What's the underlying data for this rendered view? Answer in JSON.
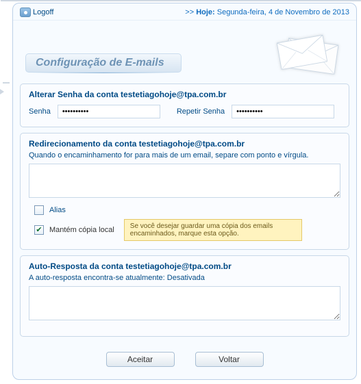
{
  "topbar": {
    "logoff_label": "Logoff",
    "date_prefix": ">> ",
    "date_bold": "Hoje:",
    "date_rest": " Segunda-feira, 4 de Novembro de 2013"
  },
  "page_title": "Configuração de E-mails",
  "account_email": "testetiagohoje@tpa.com.br",
  "password_section": {
    "heading": "Alterar Senha da conta testetiagohoje@tpa.com.br",
    "label1": "Senha",
    "value1": "••••••••••",
    "label2": "Repetir Senha",
    "value2": "••••••••••"
  },
  "redirect_section": {
    "heading": "Redirecionamento da conta testetiagohoje@tpa.com.br",
    "instructions": "Quando o encaminhamento for para mais de um email, separe com ponto e vírgula.",
    "forward_value": "",
    "alias_label": "Alias",
    "alias_checked": false,
    "keepcopy_label": "Mantém cópia local",
    "keepcopy_checked": true,
    "keepcopy_hint": "Se você desejar guardar uma cópia dos emails encaminhados, marque esta opção."
  },
  "autoresp_section": {
    "heading": "Auto-Resposta da conta testetiagohoje@tpa.com.br",
    "status_text": "A auto-resposta encontra-se atualmente: Desativada",
    "body_value": ""
  },
  "buttons": {
    "accept": "Aceitar",
    "back": "Voltar"
  }
}
